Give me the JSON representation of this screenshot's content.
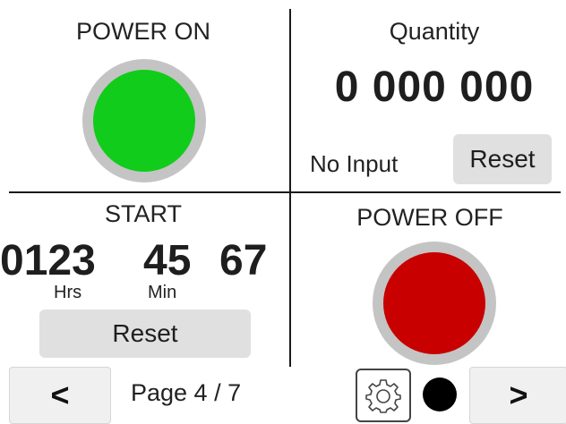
{
  "power_on": {
    "title": "POWER ON",
    "indicator_color": "#11cc1b"
  },
  "quantity": {
    "title": "Quantity",
    "value": "0 000 000",
    "input_status": "No Input",
    "reset_label": "Reset"
  },
  "start": {
    "title": "START",
    "hours": "0123",
    "minutes": "45",
    "seconds": "67",
    "hours_unit": "Hrs",
    "minutes_unit": "Min",
    "reset_label": "Reset"
  },
  "power_off": {
    "title": "POWER OFF",
    "indicator_color": "#c80000"
  },
  "footer": {
    "prev_symbol": "<",
    "page_label": "Page 4 / 7",
    "next_symbol": ">",
    "settings_icon": "gear-icon",
    "status_dot_color": "#000000"
  }
}
